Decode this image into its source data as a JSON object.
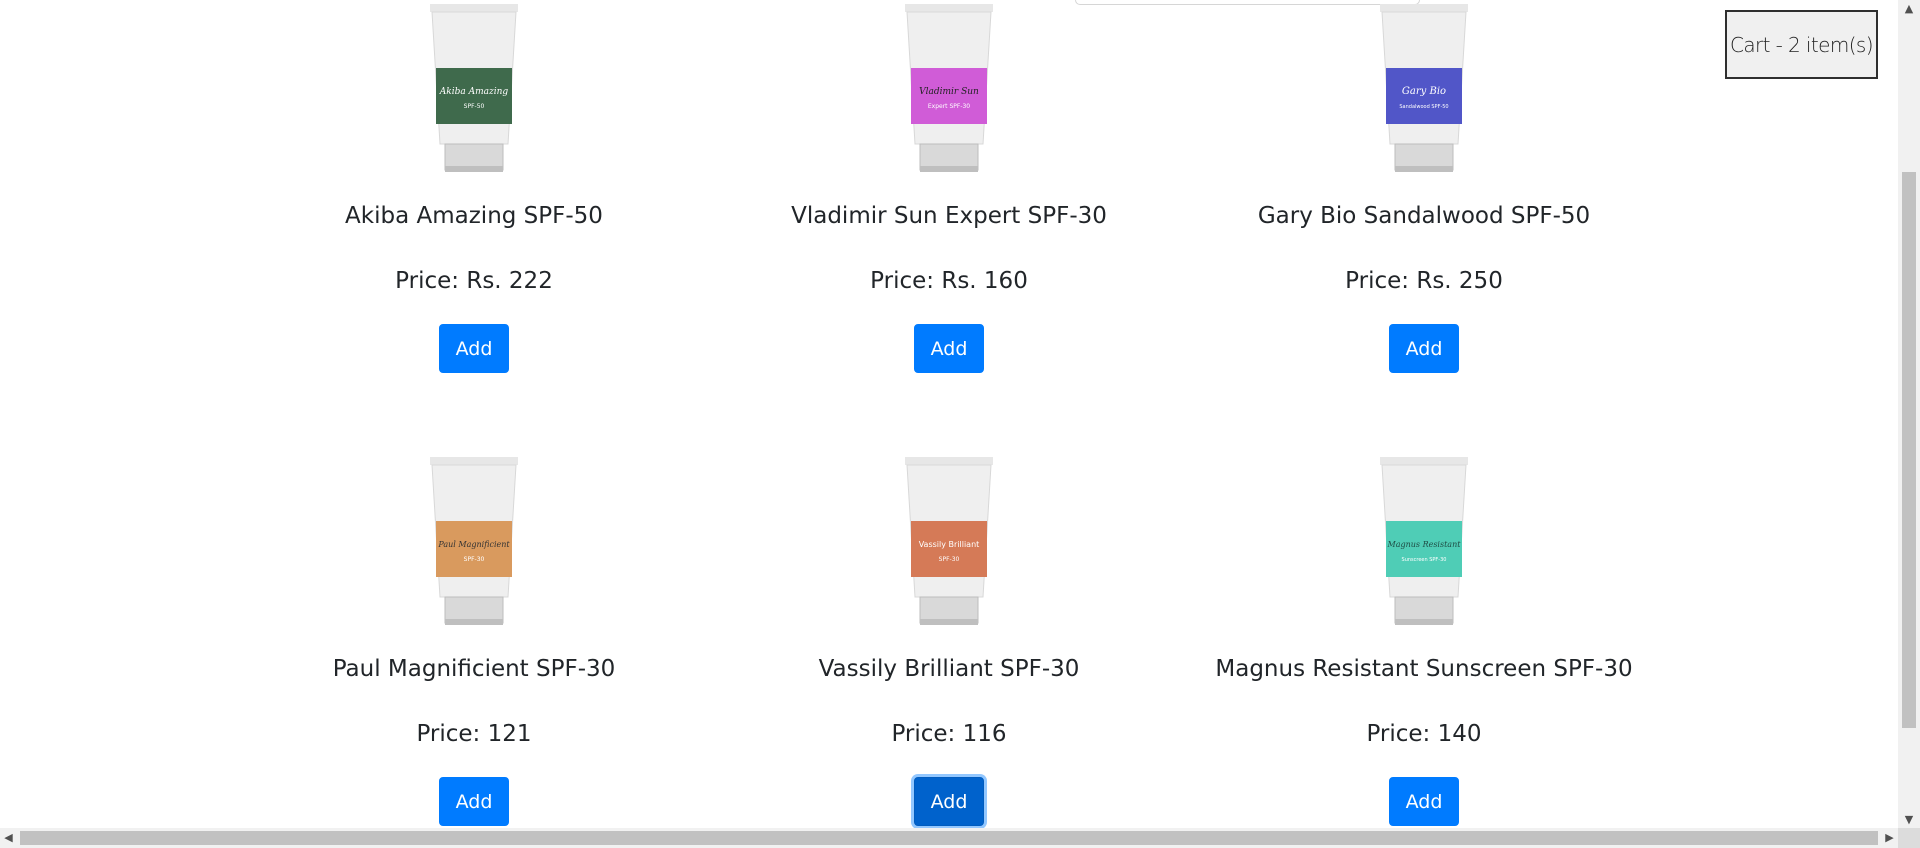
{
  "cart": {
    "label": "Cart - 2 item(s)"
  },
  "products": [
    {
      "name": "Akiba Amazing SPF-50",
      "price": "Price: Rs. 222",
      "add": "Add",
      "tube_label": "Akiba Amazing",
      "tube_sub": "SPF-50",
      "color": "#3f6a4c"
    },
    {
      "name": "Vladimir Sun Expert SPF-30",
      "price": "Price: Rs. 160",
      "add": "Add",
      "tube_label": "Vladimir Sun",
      "tube_sub": "Expert SPF-30",
      "color": "#d05cd7"
    },
    {
      "name": "Gary Bio Sandalwood SPF-50",
      "price": "Price: Rs. 250",
      "add": "Add",
      "tube_label": "Gary Bio",
      "tube_sub": "Sandalwood SPF-50",
      "color": "#5156c8"
    },
    {
      "name": "Paul Magnificient SPF-30",
      "price": "Price: 121",
      "add": "Add",
      "tube_label": "Paul Magnificient",
      "tube_sub": "SPF-30",
      "color": "#d99a5e"
    },
    {
      "name": "Vassily Brilliant SPF-30",
      "price": "Price: 116",
      "add": "Add",
      "tube_label": "Vassily Brilliant",
      "tube_sub": "SPF-30",
      "color": "#d57a57"
    },
    {
      "name": "Magnus Resistant Sunscreen SPF-30",
      "price": "Price: 140",
      "add": "Add",
      "tube_label": "Magnus Resistant",
      "tube_sub": "Sunscreen SPF-30",
      "color": "#4fcdb6"
    }
  ],
  "colors": {
    "button": "#007bff",
    "button_focus": "#0062cc"
  }
}
